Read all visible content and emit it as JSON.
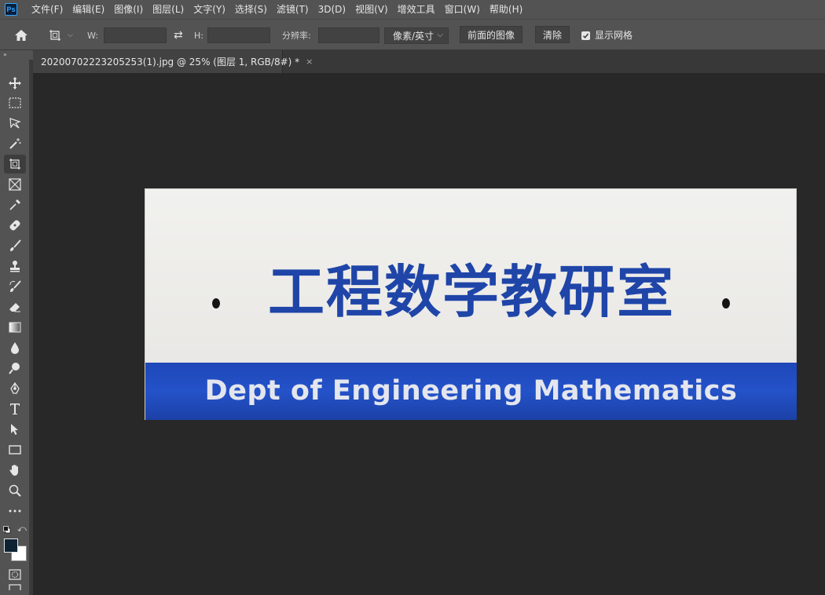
{
  "app": {
    "logo_text": "Ps"
  },
  "menu": [
    "文件(F)",
    "编辑(E)",
    "图像(I)",
    "图层(L)",
    "文字(Y)",
    "选择(S)",
    "滤镜(T)",
    "3D(D)",
    "视图(V)",
    "增效工具",
    "窗口(W)",
    "帮助(H)"
  ],
  "options": {
    "w_label": "W:",
    "w_value": "",
    "h_label": "H:",
    "h_value": "",
    "resolution_label": "分辨率:",
    "resolution_value": "",
    "unit_selected": "像素/英寸",
    "front_image_label": "前面的图像",
    "clear_label": "清除",
    "show_grid_label": "显示网格",
    "show_grid_checked": true
  },
  "document": {
    "tab_title": "20200702223205253(1).jpg @ 25% (图层 1, RGB/8#) *",
    "close_glyph": "×"
  },
  "toolbar": {
    "collapse_glyph": "»",
    "active_tool": "perspective-crop-tool",
    "foreground_color": "#0e2233",
    "background_color": "#ffffff"
  },
  "image": {
    "chinese_text": "工程数学教研室",
    "english_text": "Dept of Engineering Mathematics",
    "text_color": "#1f45a8",
    "band_color": "#2452c9"
  }
}
